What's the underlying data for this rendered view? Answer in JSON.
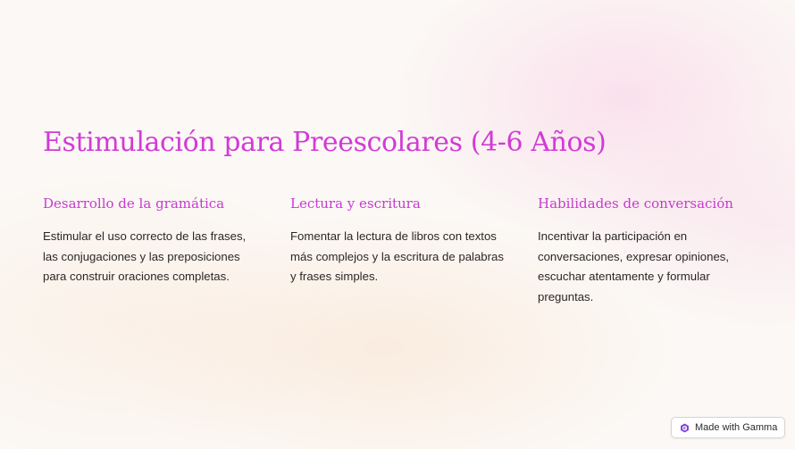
{
  "slide": {
    "title": "Estimulación para Preescolares (4-6 Años)",
    "columns": [
      {
        "heading": "Desarrollo de la gramática",
        "body": "Estimular el uso correcto de las frases, las conjugaciones y las preposiciones para construir oraciones completas."
      },
      {
        "heading": "Lectura y escritura",
        "body": "Fomentar la lectura de libros con textos más complejos y la escritura de palabras y frases simples."
      },
      {
        "heading": "Habilidades de conversación",
        "body": "Incentivar la participación en conversaciones, expresar opiniones, escuchar atentamente y formular preguntas."
      }
    ]
  },
  "badge": {
    "label": "Made with Gamma",
    "icon": "gamma-logo-icon"
  },
  "colors": {
    "accent": "#d13bd6",
    "heading": "#c73ad0",
    "body_text": "#2c2626",
    "background": "#fbf8f5"
  }
}
